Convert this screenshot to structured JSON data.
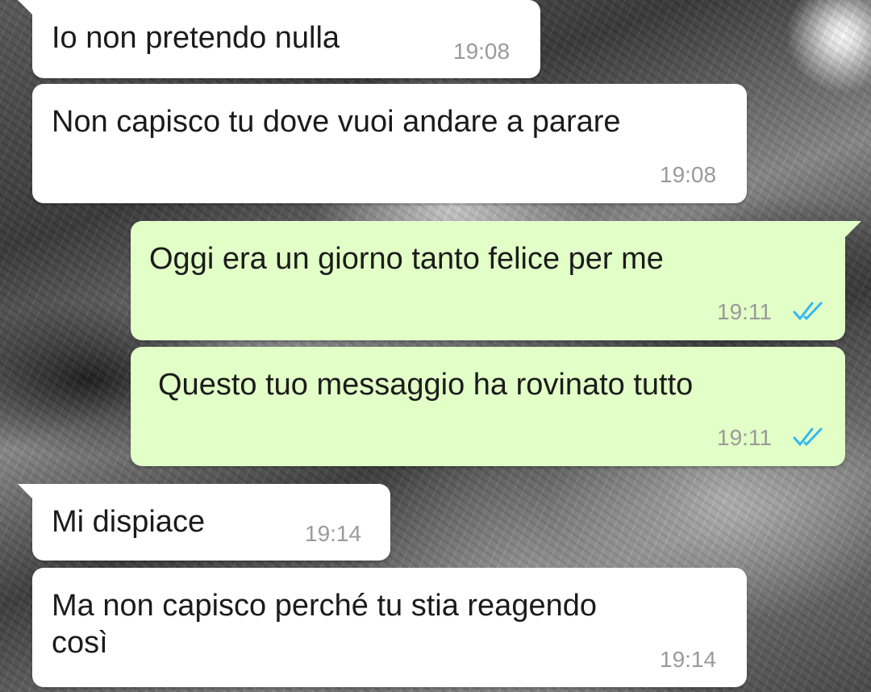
{
  "conversation": {
    "messages": [
      {
        "direction": "incoming",
        "text": "Io non pretendo nulla",
        "time": "19:08"
      },
      {
        "direction": "incoming",
        "text": "Non capisco tu dove vuoi andare a parare",
        "time": "19:08"
      },
      {
        "direction": "outgoing",
        "text": "Oggi era un giorno tanto felice per me",
        "time": "19:11",
        "status_icon": "double-check-read-icon"
      },
      {
        "direction": "outgoing",
        "text": "Questo tuo messaggio ha rovinato tutto",
        "time": "19:11",
        "status_icon": "double-check-read-icon"
      },
      {
        "direction": "incoming",
        "text": "Mi dispiace",
        "time": "19:14"
      },
      {
        "direction": "incoming",
        "text": "Ma non capisco perché tu stia reagendo\ncosì",
        "time": "19:14"
      }
    ]
  },
  "colors": {
    "incoming_bubble": "#ffffff",
    "outgoing_bubble": "#e2ffc7",
    "timestamp": "#9a9a9a",
    "read_ticks": "#34b7f1"
  }
}
